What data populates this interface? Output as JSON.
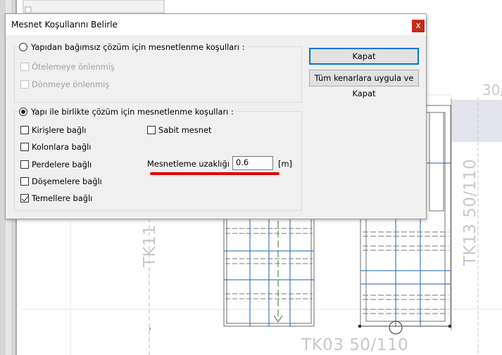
{
  "dialog": {
    "title": "Mesnet Koşullarını Belirle",
    "close_label": "x",
    "independent": {
      "label": "Yapıdan bağımsız çözüm için mesnetlenme koşulları  :",
      "options": [
        "Ötelemeye önlenmiş",
        "Dönmeye önlenmiş"
      ]
    },
    "together": {
      "label": "Yapı ile birlikte çözüm için mesnetlenme koşulları  :",
      "options": {
        "kirislere": "Kirişlere bağlı",
        "kolonlara": "Kolonlara bağlı",
        "perdelere": "Perdelere bağlı",
        "dosemelere": "Döşemelere bağlı",
        "temellere": "Temellere bağlı",
        "sabit": "Sabit mesnet"
      }
    },
    "distance": {
      "label": "Mesnetleme uzaklığı  :",
      "value": "0.6",
      "unit": "[m]"
    },
    "buttons": {
      "close": "Kapat",
      "apply_all": "Tüm kenarlara uygula ve Kapat"
    }
  },
  "cad": {
    "labels": [
      "TK11",
      "TK13 50/110",
      "TK03 50/110",
      "30/"
    ]
  }
}
